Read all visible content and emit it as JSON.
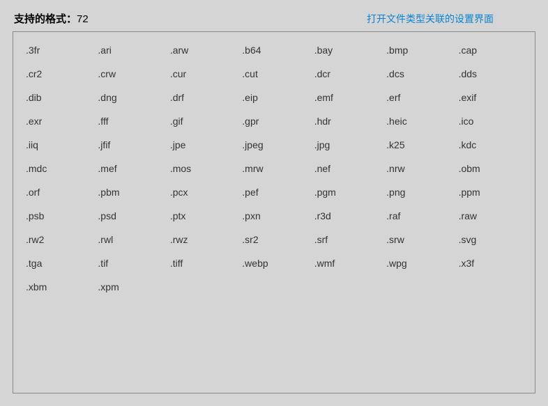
{
  "header": {
    "title_label": "支持的格式：",
    "count": "72",
    "link_text": "打开文件类型关联的设置界面"
  },
  "formats": [
    ".3fr",
    ".ari",
    ".arw",
    ".b64",
    ".bay",
    ".bmp",
    ".cap",
    ".cr2",
    ".crw",
    ".cur",
    ".cut",
    ".dcr",
    ".dcs",
    ".dds",
    ".dib",
    ".dng",
    ".drf",
    ".eip",
    ".emf",
    ".erf",
    ".exif",
    ".exr",
    ".fff",
    ".gif",
    ".gpr",
    ".hdr",
    ".heic",
    ".ico",
    ".iiq",
    ".jfif",
    ".jpe",
    ".jpeg",
    ".jpg",
    ".k25",
    ".kdc",
    ".mdc",
    ".mef",
    ".mos",
    ".mrw",
    ".nef",
    ".nrw",
    ".obm",
    ".orf",
    ".pbm",
    ".pcx",
    ".pef",
    ".pgm",
    ".png",
    ".ppm",
    ".psb",
    ".psd",
    ".ptx",
    ".pxn",
    ".r3d",
    ".raf",
    ".raw",
    ".rw2",
    ".rwl",
    ".rwz",
    ".sr2",
    ".srf",
    ".srw",
    ".svg",
    ".tga",
    ".tif",
    ".tiff",
    ".webp",
    ".wmf",
    ".wpg",
    ".x3f",
    ".xbm",
    ".xpm"
  ]
}
